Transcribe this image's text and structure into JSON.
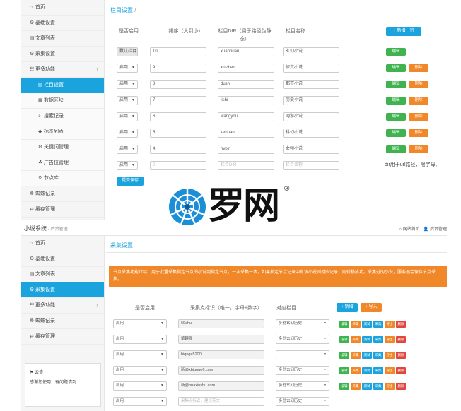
{
  "top": {
    "nav": [
      {
        "icon": "home-icon",
        "glyph": "⌂",
        "label": "首页"
      },
      {
        "icon": "gear-icon",
        "glyph": "⚙",
        "label": "基础设置"
      },
      {
        "icon": "document-icon",
        "glyph": "▤",
        "label": "文章列表"
      },
      {
        "icon": "gears-icon",
        "glyph": "⚙",
        "label": "采集设置"
      },
      {
        "icon": "sitemap-icon",
        "glyph": "☷",
        "label": "更多功能"
      },
      {
        "icon": "list-icon",
        "glyph": "▤",
        "label": "栏目设置"
      },
      {
        "icon": "database-icon",
        "glyph": "▦",
        "label": "数据区块"
      },
      {
        "icon": "search-icon",
        "glyph": "⌕",
        "label": "搜索记录"
      },
      {
        "icon": "tag-icon",
        "glyph": "◆",
        "label": "标签列表"
      },
      {
        "icon": "keywords-icon",
        "glyph": "⚙",
        "label": "关键词管理"
      },
      {
        "icon": "ad-icon",
        "glyph": "☘",
        "label": "广告位管理"
      },
      {
        "icon": "node-icon",
        "glyph": "⚲",
        "label": "节点库"
      },
      {
        "icon": "spider-icon",
        "glyph": "☸",
        "label": "蜘蛛记录"
      },
      {
        "icon": "cache-icon",
        "glyph": "⇄",
        "label": "缓存管理"
      }
    ],
    "title": "栏目设置",
    "title_sep": "/",
    "headers": {
      "enable": "是否启用",
      "sort": "排序（大到小）",
      "dir": "栏目DIR（用于路径伪静态）",
      "name": "栏目名称"
    },
    "add_row": "+ 新增一行",
    "default_label": "默认栏目",
    "edit": "编辑",
    "delete": "删除",
    "rows": [
      {
        "enable": "默认栏目",
        "sort": "10",
        "dir": "xuanhuan",
        "name": "玄幻小说"
      },
      {
        "enable": "启用",
        "sort": "9",
        "dir": "xiuzhen",
        "name": "修真小说"
      },
      {
        "enable": "启用",
        "sort": "8",
        "dir": "dushi",
        "name": "都市小说"
      },
      {
        "enable": "启用",
        "sort": "7",
        "dir": "lishi",
        "name": "历史小说"
      },
      {
        "enable": "启用",
        "sort": "6",
        "dir": "wangyou",
        "name": "网游小说"
      },
      {
        "enable": "启用",
        "sort": "5",
        "dir": "kehuan",
        "name": "科幻小说"
      },
      {
        "enable": "启用",
        "sort": "4",
        "dir": "nvpin",
        "name": "女频小说"
      }
    ],
    "new_row": {
      "enable": "启用",
      "sort": "0",
      "dir_placeholder": "栏目DIR",
      "name_placeholder": "栏目名称"
    },
    "dir_note": "dir用于url路径，限字母、",
    "save": "提交保存"
  },
  "logo": {
    "text": "罗网",
    "reg": "®",
    "brand_color": "#1a8fd8"
  },
  "bottom": {
    "app_name": "小说系统",
    "app_sub": "/ 后台管理",
    "site_home": "网站首页",
    "admin": "后台管理",
    "nav": [
      {
        "icon": "home-icon",
        "glyph": "⌂",
        "label": "首页"
      },
      {
        "icon": "gear-icon",
        "glyph": "⚙",
        "label": "基础设置"
      },
      {
        "icon": "document-icon",
        "glyph": "▤",
        "label": "文章列表"
      },
      {
        "icon": "gears-icon",
        "glyph": "⚙",
        "label": "采集设置"
      },
      {
        "icon": "sitemap-icon",
        "glyph": "☷",
        "label": "更多功能"
      },
      {
        "icon": "spider-icon",
        "glyph": "☸",
        "label": "蜘蛛记录"
      },
      {
        "icon": "cache-icon",
        "glyph": "⇄",
        "label": "缓存管理"
      }
    ],
    "notice_title": "公告",
    "notice_text": "感谢您使用！有问题请到",
    "title": "采集设置",
    "banner": "节点采集功能介绍：用于批量采集指定节点的小说到指定节点。一次采集一本，如果指定节点记录中有该小说则对应记录，则转移成功。采集过的小说，服务器会保存节点采集。",
    "headers": {
      "enable": "是否启用",
      "tag": "采集点标识（唯一，字母+数字）",
      "column": "对应栏目"
    },
    "add_btn": "+ 新增",
    "import_btn": "+ 导入",
    "row_buttons": [
      "编辑",
      "采集",
      "测试",
      "采集",
      "导出",
      "删除"
    ],
    "rows": [
      {
        "enable": "启用",
        "tag": "69shu",
        "column": "多处玄幻历史"
      },
      {
        "enable": "启用",
        "tag": "笔趣阁",
        "column": "多处玄幻历史"
      },
      {
        "enable": "启用",
        "tag": "biquge5200",
        "column": ""
      },
      {
        "enable": "启用",
        "tag": "新@xbiquge6.com",
        "column": "多处玄幻历史"
      },
      {
        "enable": "启用",
        "tag": "新@huaxiushu.com",
        "column": "多处玄幻历史"
      },
      {
        "enable": "启用",
        "tag_placeholder": "采集点标识，建议英文",
        "column": "多处玄幻历史"
      }
    ]
  }
}
